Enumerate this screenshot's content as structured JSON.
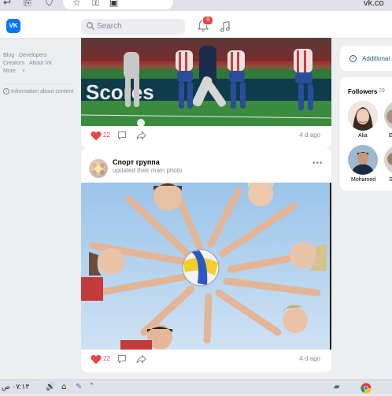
{
  "browser": {
    "url_fragment": "vk.co",
    "icons": [
      "back-icon",
      "page-icon",
      "shield-icon",
      "star-icon",
      "key-icon",
      "extension-icon"
    ]
  },
  "header": {
    "logo_text": "VK",
    "search_placeholder": "Search",
    "notifications_count": "9"
  },
  "sidebar": {
    "links": [
      "Blog",
      "Developers",
      "Creators",
      "About VK",
      "More"
    ],
    "info_link": "Information about content"
  },
  "posts": [
    {
      "likes": "22",
      "date": "4 d ago",
      "photo_text": "Scores"
    },
    {
      "group_name": "Спорт группа",
      "subtitle": "updated their main photo",
      "likes": "22",
      "date": "4 d ago"
    }
  ],
  "right_panel": {
    "additional_info": "Additional i",
    "followers_title": "Followers",
    "followers_count": "29",
    "followers": [
      {
        "name": "Alia"
      },
      {
        "name": "E"
      },
      {
        "name": "Mohamed"
      },
      {
        "name": "S"
      }
    ]
  },
  "taskbar": {
    "time": "٠٧:١٣ ص"
  },
  "colors": {
    "vk_blue": "#0077ff",
    "like_red": "#e64646",
    "link_blue": "#2a5885"
  }
}
